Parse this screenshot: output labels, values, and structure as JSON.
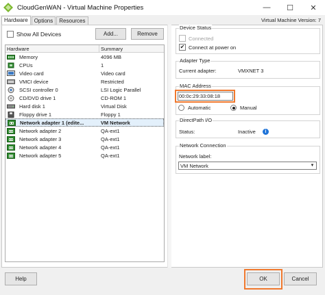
{
  "window": {
    "title": "CloudGenWAN - Virtual Machine Properties",
    "minimize": "—",
    "maximize": "☐",
    "close": "✕"
  },
  "tabs": [
    {
      "label": "Hardware",
      "active": true
    },
    {
      "label": "Options",
      "active": false
    },
    {
      "label": "Resources",
      "active": false
    }
  ],
  "version_text": "Virtual Machine Version: 7",
  "show_all_devices": {
    "label": "Show All Devices",
    "checked": false
  },
  "buttons": {
    "add": "Add...",
    "remove": "Remove",
    "help": "Help",
    "ok": "OK",
    "cancel": "Cancel"
  },
  "hardware_table": {
    "headers": [
      "Hardware",
      "Summary"
    ],
    "rows": [
      {
        "name": "Memory",
        "summary": "4096 MB",
        "icon": "memory-icon",
        "selected": false
      },
      {
        "name": "CPUs",
        "summary": "1",
        "icon": "cpu-icon",
        "selected": false
      },
      {
        "name": "Video card",
        "summary": "Video card",
        "icon": "video-card-icon",
        "selected": false
      },
      {
        "name": "VMCI device",
        "summary": "Restricted",
        "icon": "vmci-icon",
        "selected": false
      },
      {
        "name": "SCSI controller 0",
        "summary": "LSI Logic Parallel",
        "icon": "scsi-icon",
        "selected": false
      },
      {
        "name": "CD/DVD drive 1",
        "summary": "CD-ROM 1",
        "icon": "cd-dvd-icon",
        "selected": false
      },
      {
        "name": "Hard disk 1",
        "summary": "Virtual Disk",
        "icon": "hard-disk-icon",
        "selected": false
      },
      {
        "name": "Floppy drive 1",
        "summary": "Floppy 1",
        "icon": "floppy-icon",
        "selected": false
      },
      {
        "name": "Network adapter 1 (edite...",
        "summary": "VM Network",
        "icon": "network-adapter-icon",
        "selected": true
      },
      {
        "name": "Network adapter 2",
        "summary": "QA-ext1",
        "icon": "network-adapter-icon",
        "selected": false
      },
      {
        "name": "Network adapter 3",
        "summary": "QA-ext1",
        "icon": "network-adapter-icon",
        "selected": false
      },
      {
        "name": "Network adapter 4",
        "summary": "QA-ext1",
        "icon": "network-adapter-icon",
        "selected": false
      },
      {
        "name": "Network adapter 5",
        "summary": "QA-ext1",
        "icon": "network-adapter-icon",
        "selected": false
      }
    ]
  },
  "device_status": {
    "title": "Device Status",
    "connected": {
      "label": "Connected",
      "checked": false,
      "disabled": true
    },
    "connect_at_power_on": {
      "label": "Connect at power on",
      "checked": true
    }
  },
  "adapter_type": {
    "title": "Adapter Type",
    "current_label": "Current adapter:",
    "current_value": "VMXNET 3"
  },
  "mac_address": {
    "title": "MAC Address",
    "value": "00:0c:29:33:08:18",
    "automatic_label": "Automatic",
    "manual_label": "Manual",
    "selected": "manual"
  },
  "directpath": {
    "title": "DirectPath I/O",
    "status_label": "Status:",
    "status_value": "Inactive",
    "info_glyph": "i"
  },
  "network_connection": {
    "title": "Network Connection",
    "label": "Network label:",
    "value": "VM Network"
  },
  "colors": {
    "highlight": "#f0782d",
    "accent_blue": "#1e73d8",
    "icon_green": "#2e8b2e"
  }
}
